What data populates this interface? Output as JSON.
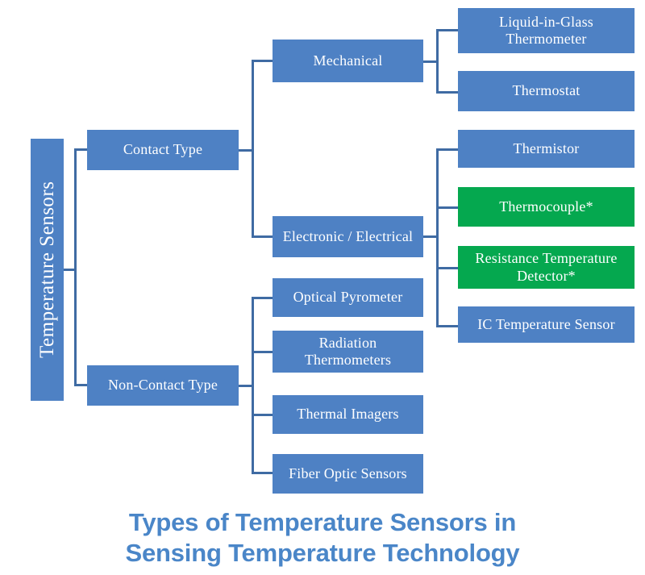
{
  "diagram": {
    "type": "tree",
    "root": {
      "label": "Temperature Sensors",
      "color": "#4e81c4"
    },
    "level1": [
      {
        "label": "Contact Type",
        "color": "#4e81c4"
      },
      {
        "label": "Non-Contact Type",
        "color": "#4e81c4"
      }
    ],
    "level2_contact": [
      {
        "label": "Mechanical",
        "color": "#4e81c4"
      },
      {
        "label": "Electronic / Electrical",
        "color": "#4e81c4"
      }
    ],
    "mechanical_children": [
      {
        "label": "Liquid-in-Glass Thermometer",
        "color": "#4e81c4"
      },
      {
        "label": "Thermostat",
        "color": "#4e81c4"
      }
    ],
    "electronic_children": [
      {
        "label": "Thermistor",
        "color": "#4e81c4"
      },
      {
        "label": "Thermocouple*",
        "color": "#05a84f"
      },
      {
        "label": "Resistance Temperature Detector*",
        "color": "#05a84f"
      },
      {
        "label": "IC Temperature Sensor",
        "color": "#4e81c4"
      }
    ],
    "noncontact_children": [
      {
        "label": "Optical Pyrometer",
        "color": "#4e81c4"
      },
      {
        "label": "Radiation Thermometers",
        "color": "#4e81c4"
      },
      {
        "label": "Thermal Imagers",
        "color": "#4e81c4"
      },
      {
        "label": "Fiber Optic Sensors",
        "color": "#4e81c4"
      }
    ]
  },
  "title": {
    "line1": "Types of Temperature Sensors in",
    "line2": "Sensing Temperature Technology",
    "color": "#4a86c8"
  },
  "colors": {
    "box_blue": "#4e81c4",
    "box_green": "#05a84f",
    "connector": "#3f6ba3",
    "text_on_box": "#ffffff",
    "background": "#ffffff"
  }
}
